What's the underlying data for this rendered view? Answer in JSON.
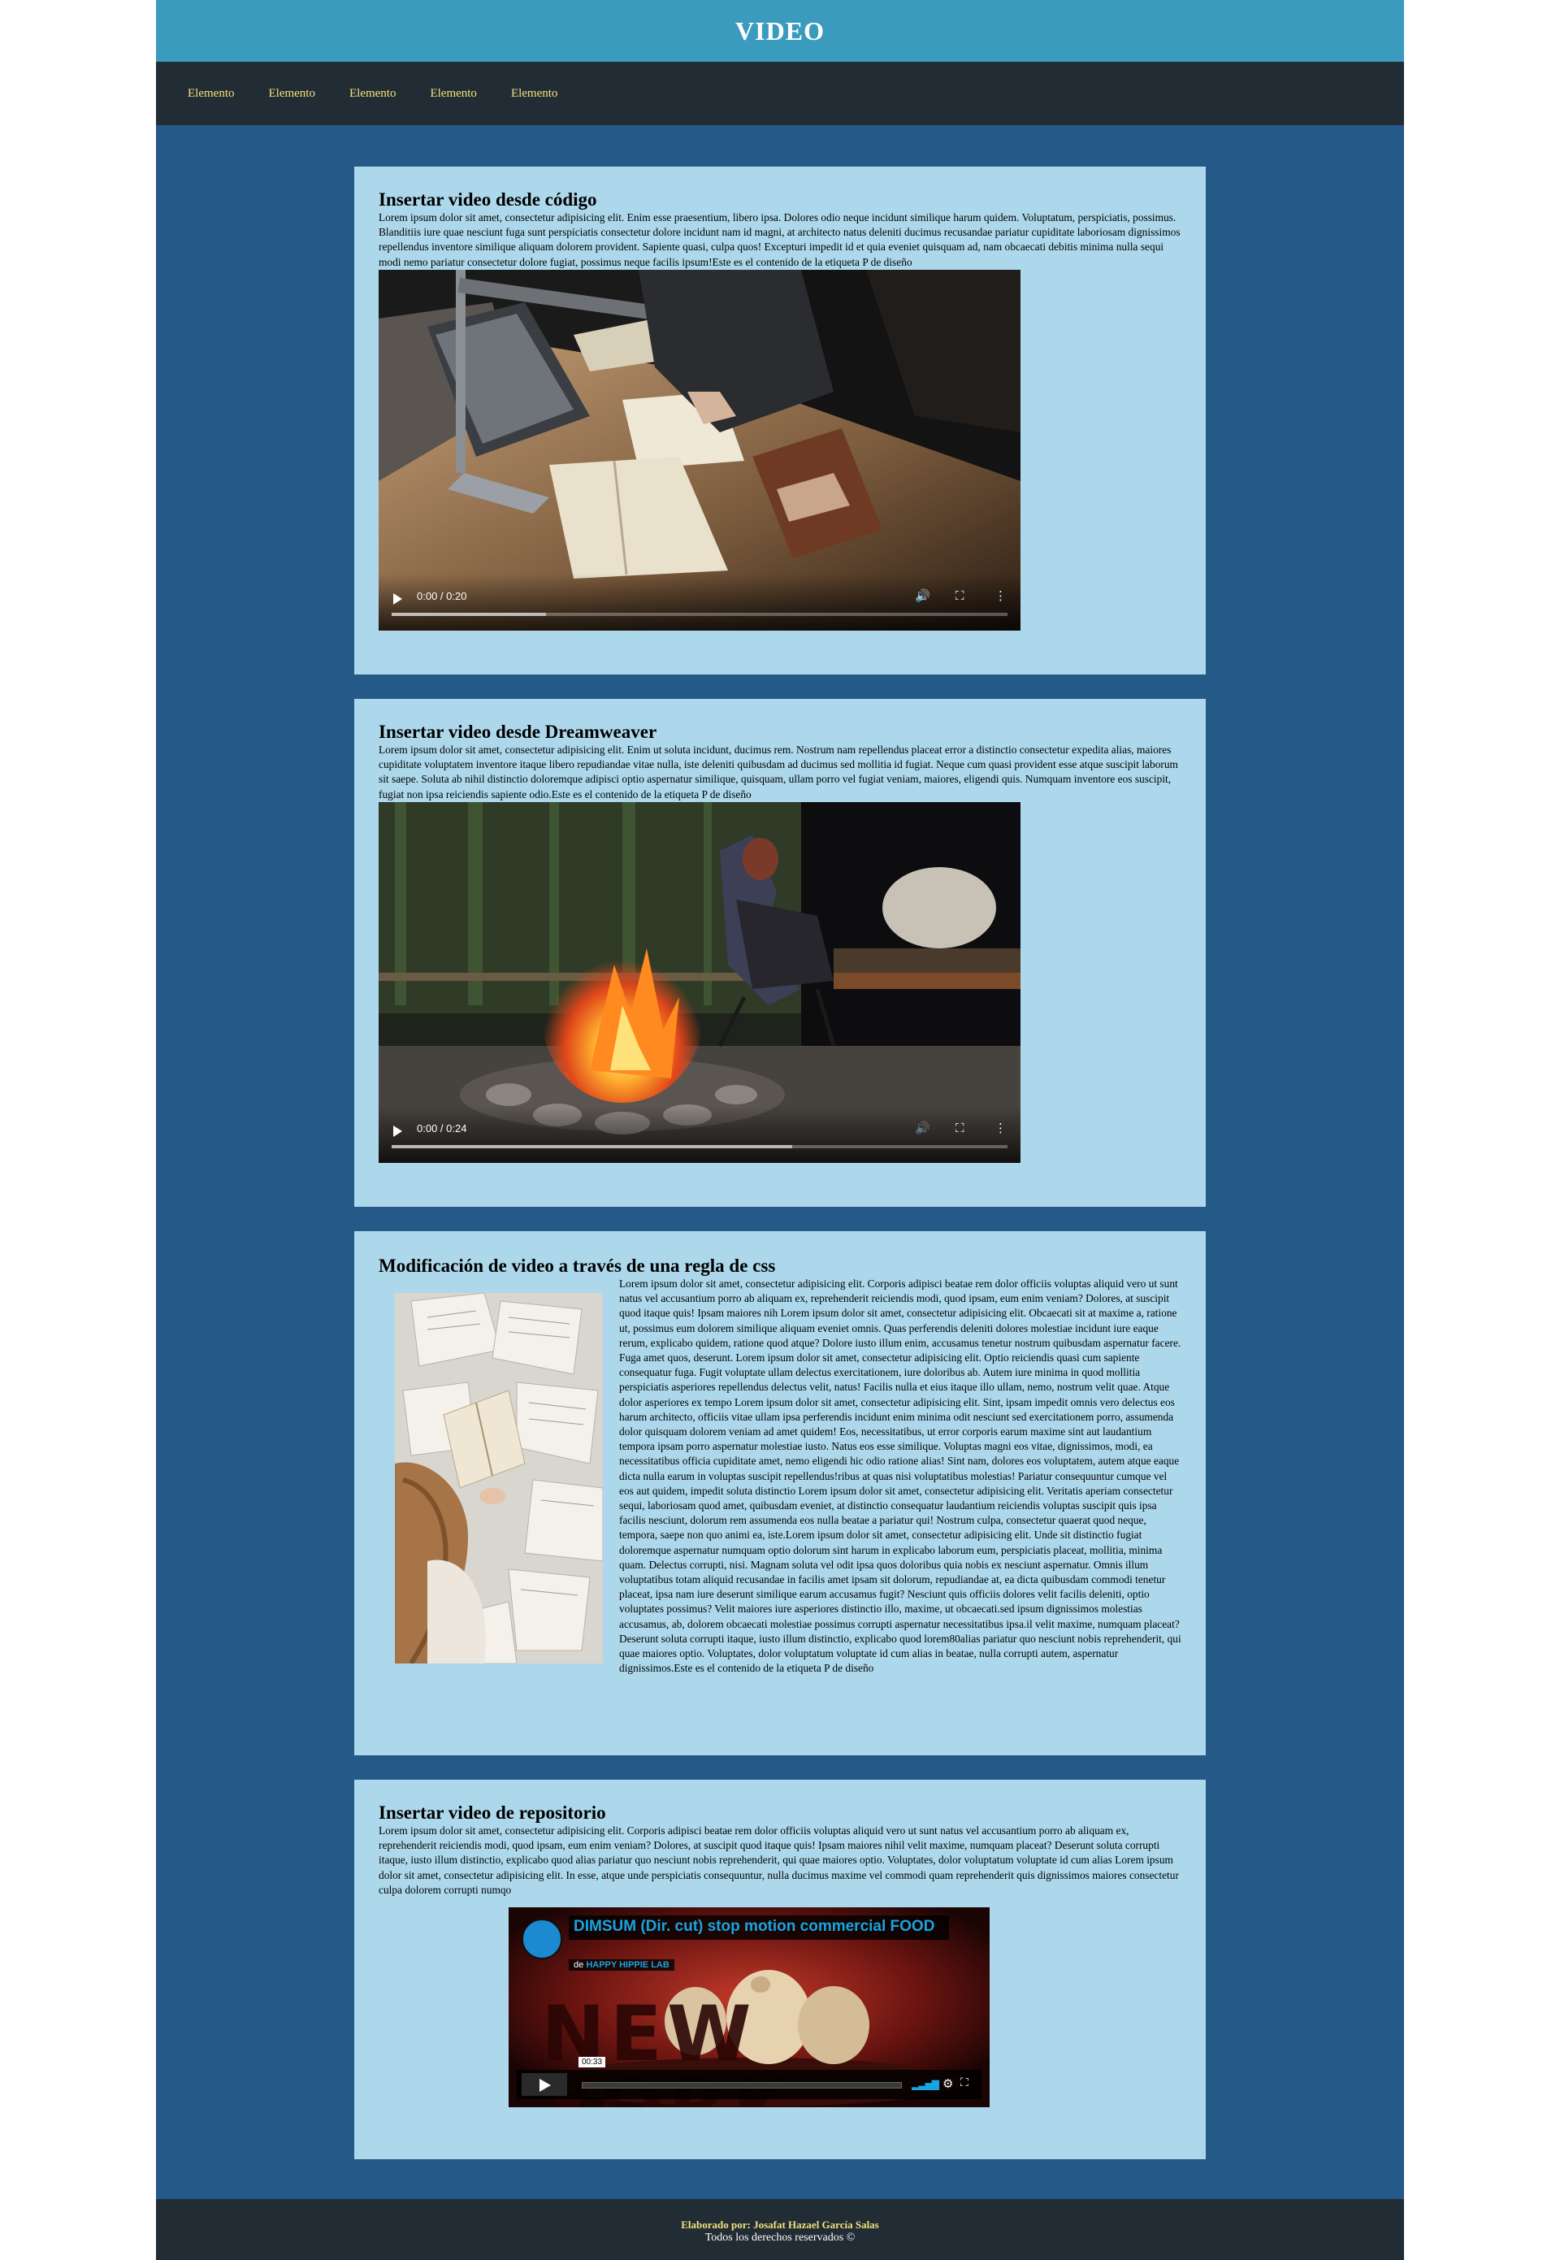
{
  "header": {
    "title": "VIDEO"
  },
  "nav": {
    "items": [
      "Elemento",
      "Elemento",
      "Elemento",
      "Elemento",
      "Elemento"
    ]
  },
  "sections": [
    {
      "heading": "Insertar video desde código",
      "text": "Lorem ipsum dolor sit amet, consectetur adipisicing elit. Enim esse praesentium, libero ipsa. Dolores odio neque incidunt similique harum quidem. Voluptatum, perspiciatis, possimus. Blanditiis iure quae nesciunt fuga sunt perspiciatis consectetur dolore incidunt nam id magni, at architecto natus deleniti ducimus recusandae pariatur cupiditate laboriosam dignissimos repellendus inventore similique aliquam dolorem provident. Sapiente quasi, culpa quos! Excepturi impedit id et quia eveniet quisquam ad, nam obcaecati debitis minima nulla sequi modi nemo pariatur consectetur dolore fugiat, possimus neque facilis ipsum!Este es el contenido de la etiqueta P de diseño",
      "video": {
        "time": "0:00 / 0:20",
        "progress": 0.25
      }
    },
    {
      "heading": "Insertar video desde Dreamweaver",
      "text": "Lorem ipsum dolor sit amet, consectetur adipisicing elit. Enim ut soluta incidunt, ducimus rem. Nostrum nam repellendus placeat error a distinctio consectetur expedita alias, maiores cupiditate voluptatem inventore itaque libero repudiandae vitae nulla, iste deleniti quibusdam ad ducimus sed mollitia id fugiat. Neque cum quasi provident esse atque suscipit laborum sit saepe. Soluta ab nihil distinctio doloremque adipisci optio aspernatur similique, quisquam, ullam porro vel fugiat veniam, maiores, eligendi quis. Numquam inventore eos suscipit, fugiat non ipsa reiciendis sapiente odio.Este es el contenido de la etiqueta P de diseño",
      "video": {
        "time": "0:00 / 0:24",
        "progress": 0.65
      }
    },
    {
      "heading": "Modificación de video a través de una regla de css",
      "text": "Lorem ipsum dolor sit amet, consectetur adipisicing elit. Corporis adipisci beatae rem dolor officiis voluptas aliquid vero ut sunt natus vel accusantium porro ab aliquam ex, reprehenderit reiciendis modi, quod ipsam, eum enim veniam? Dolores, at suscipit quod itaque quis! Ipsam maiores nih Lorem ipsum dolor sit amet, consectetur adipisicing elit. Obcaecati sit at maxime a, ratione ut, possimus eum dolorem similique aliquam eveniet omnis. Quas perferendis deleniti dolores molestiae incidunt iure eaque rerum, explicabo quidem, ratione quod atque? Dolore iusto illum enim, accusamus tenetur nostrum quibusdam aspernatur facere. Fuga amet quos, deserunt. Lorem ipsum dolor sit amet, consectetur adipisicing elit. Optio reiciendis quasi cum sapiente consequatur fuga. Fugit voluptate ullam delectus exercitationem, iure doloribus ab. Autem iure minima in quod mollitia perspiciatis asperiores repellendus delectus velit, natus! Facilis nulla et eius itaque illo ullam, nemo, nostrum velit quae. Atque dolor asperiores ex tempo Lorem ipsum dolor sit amet, consectetur adipisicing elit. Sint, ipsam impedit omnis vero delectus eos harum architecto, officiis vitae ullam ipsa perferendis incidunt enim minima odit nesciunt sed exercitationem porro, assumenda dolor quisquam dolorem veniam ad amet quidem! Eos, necessitatibus, ut error corporis earum maxime sint aut laudantium tempora ipsam porro aspernatur molestiae iusto. Natus eos esse similique. Voluptas magni eos vitae, dignissimos, modi, ea necessitatibus officia cupiditate amet, nemo eligendi hic odio ratione alias! Sint nam, dolores eos voluptatem, autem atque eaque dicta nulla earum in voluptas suscipit repellendus!ribus at quas nisi voluptatibus molestias! Pariatur consequuntur cumque vel eos aut quidem, impedit soluta distinctio Lorem ipsum dolor sit amet, consectetur adipisicing elit. Veritatis aperiam consectetur sequi, laboriosam quod amet, quibusdam eveniet, at distinctio consequatur laudantium reiciendis voluptas suscipit quis ipsa facilis nesciunt, dolorum rem assumenda eos nulla beatae a pariatur qui! Nostrum culpa, consectetur quaerat quod neque, tempora, saepe non quo animi ea, iste.Lorem ipsum dolor sit amet, consectetur adipisicing elit. Unde sit distinctio fugiat doloremque aspernatur numquam optio dolorum sint harum in explicabo laborum eum, perspiciatis placeat, mollitia, minima quam. Delectus corrupti, nisi. Magnam soluta vel odit ipsa quos doloribus quia nobis ex nesciunt aspernatur. Omnis illum voluptatibus totam aliquid recusandae in facilis amet ipsam sit dolorum, repudiandae at, ea dicta quibusdam commodi tenetur placeat, ipsa nam iure deserunt similique earum accusamus fugit? Nesciunt quis officiis dolores velit facilis deleniti, optio voluptates possimus? Velit maiores iure asperiores distinctio illo, maxime, ut obcaecati.sed ipsum dignissimos molestias accusamus, ab, dolorem obcaecati molestiae possimus corrupti aspernatur necessitatibus ipsa.il velit maxime, numquam placeat? Deserunt soluta corrupti itaque, iusto illum distinctio, explicabo quod lorem80alias pariatur quo nesciunt nobis reprehenderit, qui quae maiores optio. Voluptates, dolor voluptatum voluptate id cum alias in beatae, nulla corrupti autem, aspernatur dignissimos.Este es el contenido de la etiqueta P de diseño"
    },
    {
      "heading": "Insertar video de repositorio",
      "text": "Lorem ipsum dolor sit amet, consectetur adipisicing elit. Corporis adipisci beatae rem dolor officiis voluptas aliquid vero ut sunt natus vel accusantium porro ab aliquam ex, reprehenderit reiciendis modi, quod ipsam, eum enim veniam? Dolores, at suscipit quod itaque quis! Ipsam maiores nihil velit maxime, numquam placeat? Deserunt soluta corrupti itaque, iusto illum distinctio, explicabo quod alias pariatur quo nesciunt nobis reprehenderit, qui quae maiores optio. Voluptates, dolor voluptatum voluptate id cum alias Lorem ipsum dolor sit amet, consectetur adipisicing elit. In esse, atque unde perspiciatis consequuntur, nulla ducimus maxime vel commodi quam reprehenderit quis dignissimos maiores consectetur culpa dolorem corrupti numqo",
      "embed": {
        "title": "DIMSUM (Dir. cut) stop motion commercial FOOD",
        "by_prefix": "de",
        "by_author": "HAPPY HIPPIE LAB",
        "background_text": "NEW YORK",
        "duration": "00:33"
      }
    }
  ],
  "footer": {
    "author": "Elaborado por: Josafat Hazael García Salas",
    "rights": "Todos los derechos reservados ©"
  },
  "colors": {
    "page_bg": "#255987",
    "header_bg": "#3a9bbf",
    "nav_bg": "#222c35",
    "nav_link": "#f2e27a",
    "card_bg": "#add8eb",
    "embed_accent": "#18a4e0"
  },
  "icons": [
    "play-icon",
    "volume-icon",
    "fullscreen-icon",
    "more-options-icon",
    "settings-icon"
  ]
}
